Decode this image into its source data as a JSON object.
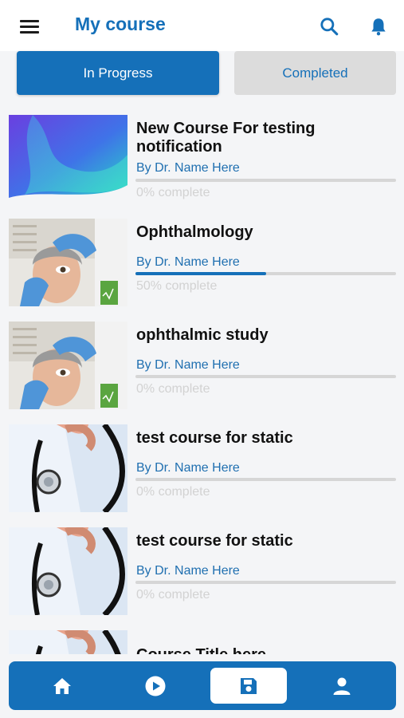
{
  "header": {
    "title": "My course"
  },
  "tabs": [
    {
      "label": "In Progress",
      "active": true
    },
    {
      "label": "Completed",
      "active": false
    }
  ],
  "courses": [
    {
      "title": "New Course For testing notification",
      "author": "By Dr. Name Here",
      "progress_text": "0% complete",
      "progress": 0,
      "thumbnail": "gradient-abstract"
    },
    {
      "title": "Ophthalmology",
      "author": "By Dr. Name Here",
      "progress_text": "50% complete",
      "progress": 0.5,
      "thumbnail": "eye-exam"
    },
    {
      "title": "ophthalmic study",
      "author": "By Dr. Name Here",
      "progress_text": "0% complete",
      "progress": 0,
      "thumbnail": "eye-exam"
    },
    {
      "title": "test course for static",
      "author": "By Dr. Name Here",
      "progress_text": "0% complete",
      "progress": 0,
      "thumbnail": "stethoscope"
    },
    {
      "title": "test course for static",
      "author": "By Dr. Name Here",
      "progress_text": "0% complete",
      "progress": 0,
      "thumbnail": "stethoscope"
    },
    {
      "title": "Course Title here",
      "author": "",
      "progress_text": "",
      "progress": 0,
      "thumbnail": "stethoscope"
    }
  ],
  "bottom_nav": [
    {
      "icon": "home-icon",
      "active": false
    },
    {
      "icon": "play-icon",
      "active": false
    },
    {
      "icon": "save-icon",
      "active": true
    },
    {
      "icon": "profile-icon",
      "active": false
    }
  ],
  "colors": {
    "primary": "#1570b9",
    "tab_inactive": "#dcdcdc",
    "background": "#f4f5f7",
    "progress_track": "#d6d6d6"
  }
}
